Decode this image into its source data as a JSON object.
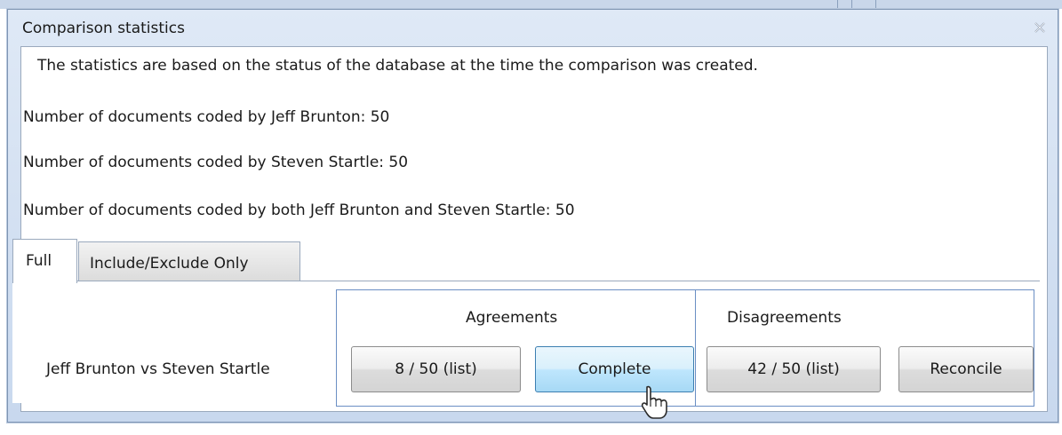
{
  "dialog": {
    "title": "Comparison statistics",
    "close_icon": "close-icon",
    "intro": "The statistics are based on the status of the database at the time the comparison was created.",
    "stats": [
      "Number of documents coded by Jeff Brunton: 50",
      "Number of documents coded by Steven Startle: 50",
      "Number of documents coded by both Jeff Brunton and Steven Startle: 50"
    ]
  },
  "tabs": [
    {
      "label": "Full",
      "active": true
    },
    {
      "label": "Include/Exclude Only",
      "active": false
    }
  ],
  "comparison": {
    "row_label": "Jeff Brunton vs Steven Startle",
    "agreements_header": "Agreements",
    "disagreements_header": "Disagreements",
    "agreements_list_label": "8 / 50 (list)",
    "complete_label": "Complete",
    "disagreements_list_label": "42 / 50 (list)",
    "reconcile_label": "Reconcile"
  },
  "colors": {
    "titlebar": "#dfe9f6",
    "hover_button": "#bee6fd",
    "group_border": "#6b8fc4"
  }
}
